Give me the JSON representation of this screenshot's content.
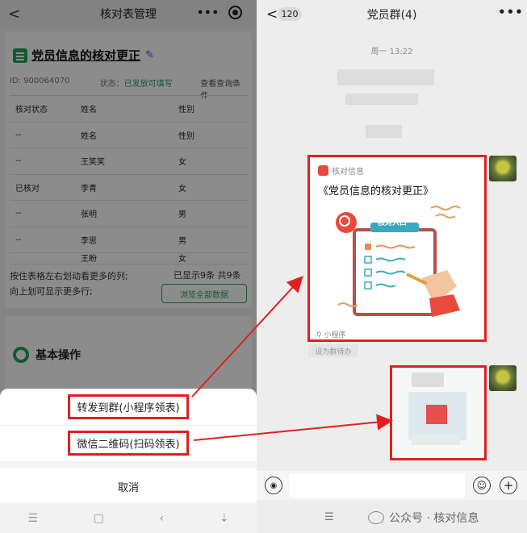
{
  "left": {
    "nav": {
      "back": "<",
      "title": "核对表管理",
      "dots": "•••"
    },
    "card": {
      "title": "党员信息的核对更正",
      "id_text": "ID: 900064070",
      "status_prefix": "状态：",
      "status_value": "已发放可填写",
      "query_link": "查看查询条件",
      "table": {
        "headers": [
          "核对状态",
          "姓名",
          "性别"
        ],
        "rows": [
          [
            "--",
            "姓名",
            "性别"
          ],
          [
            "--",
            "王笑笑",
            "女"
          ],
          [
            "已核对",
            "李青",
            "女"
          ],
          [
            "--",
            "张明",
            "男"
          ],
          [
            "--",
            "李思",
            "男"
          ],
          [
            "",
            "王盼",
            "女"
          ]
        ]
      },
      "hint_line1": "按住表格左右划动看更多的列;",
      "hint_line2": "向上划可显示更多行;",
      "count": "已显示9条 共9条",
      "browse_all": "浏览全部数据"
    },
    "operations": {
      "title": "基本操作"
    },
    "sheet": {
      "forward_group": "转发到群(小程序领表)",
      "qr_code": "微信二维码(扫码领表)",
      "cancel": "取消"
    },
    "sysnav": [
      "☰",
      "▢",
      "‹",
      "⇣"
    ]
  },
  "right": {
    "nav": {
      "back": "<",
      "unread": "120",
      "title": "党员群(4)",
      "more": "•••"
    },
    "time": "周一 13:22",
    "miniprogram": {
      "source": "核对信息",
      "title": "《党员信息的核对更正》",
      "badge": "核对入口",
      "footer": "小程序"
    },
    "status_chip": "设为群待办",
    "input": {
      "voice_icon": "voice-icon",
      "emoji_icon": "emoji-icon",
      "plus_icon": "plus-icon"
    },
    "sysnav_menu": "☰",
    "watermark": "公众号 · 核对信息"
  },
  "colors": {
    "accent_green": "#1fa35a",
    "highlight_red": "#e02020",
    "brand_red": "#e84b3c"
  }
}
